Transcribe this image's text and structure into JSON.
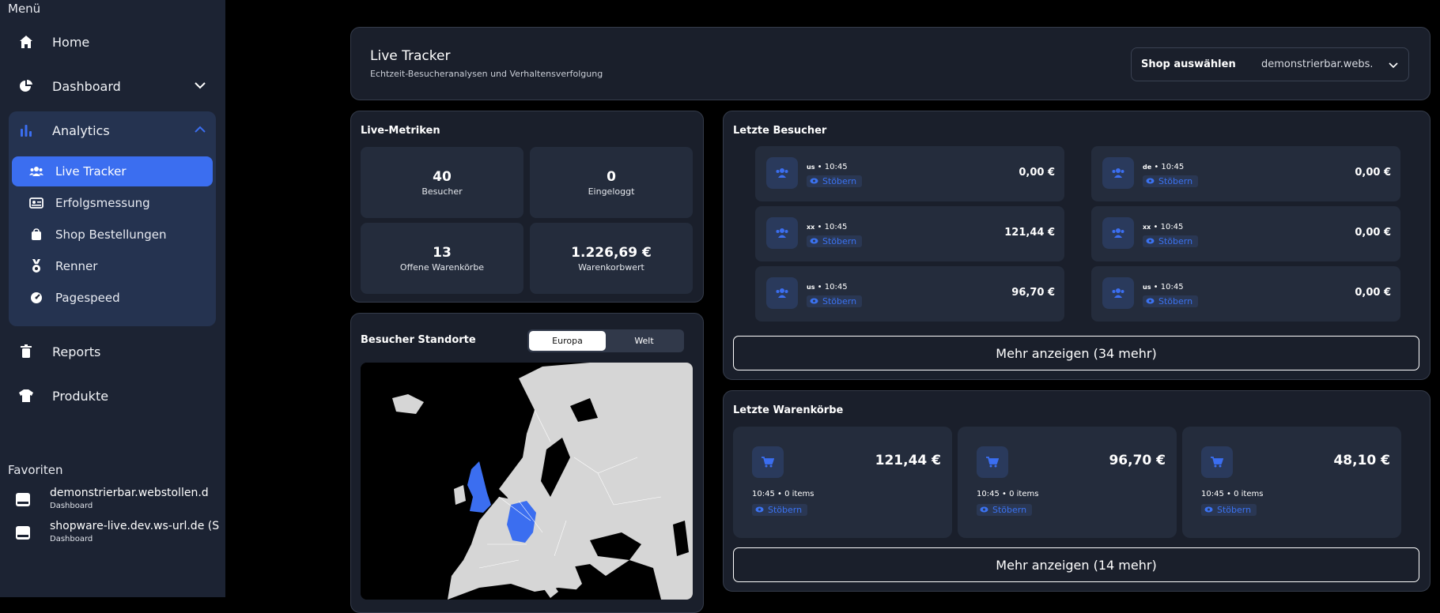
{
  "sidebar": {
    "menu_title": "Menü",
    "items": {
      "home": "Home",
      "dashboard": "Dashboard",
      "analytics": "Analytics",
      "reports": "Reports",
      "produkte": "Produkte"
    },
    "analytics_sub": {
      "live_tracker": "Live Tracker",
      "erfolgsmessung": "Erfolgsmessung",
      "shop_bestellungen": "Shop Bestellungen",
      "renner": "Renner",
      "pagespeed": "Pagespeed"
    },
    "favorites_title": "Favoriten",
    "favorites": [
      {
        "name": "demonstrierbar.webstollen.d",
        "sub": "Dashboard"
      },
      {
        "name": "shopware-live.dev.ws-url.de (S",
        "sub": "Dashboard"
      }
    ]
  },
  "header": {
    "title": "Live Tracker",
    "subtitle": "Echtzeit-Besucheranalysen und Verhaltensverfolgung",
    "shop_label": "Shop auswählen",
    "shop_value": "demonstrierbar.webs..."
  },
  "metrics": {
    "title": "Live-Metriken",
    "items": [
      {
        "value": "40",
        "label": "Besucher"
      },
      {
        "value": "0",
        "label": "Eingeloggt"
      },
      {
        "value": "13",
        "label": "Offene Warenkörbe"
      },
      {
        "value": "1.226,69 €",
        "label": "Warenkorbwert"
      }
    ]
  },
  "locations": {
    "title": "Besucher Standorte",
    "tab_europa": "Europa",
    "tab_welt": "Welt",
    "active_tab": "Europa",
    "highlight_color": "#3b6ef0"
  },
  "visitors": {
    "title": "Letzte Besucher",
    "items": [
      {
        "country": "us",
        "time": "• 10:45",
        "status": "Stöbern",
        "amount": "0,00 €"
      },
      {
        "country": "de",
        "time": "• 10:45",
        "status": "Stöbern",
        "amount": "0,00 €"
      },
      {
        "country": "xx",
        "time": "• 10:45",
        "status": "Stöbern",
        "amount": "121,44 €"
      },
      {
        "country": "xx",
        "time": "• 10:45",
        "status": "Stöbern",
        "amount": "0,00 €"
      },
      {
        "country": "us",
        "time": "• 10:45",
        "status": "Stöbern",
        "amount": "96,70 €"
      },
      {
        "country": "us",
        "time": "• 10:45",
        "status": "Stöbern",
        "amount": "0,00 €"
      }
    ],
    "more": "Mehr anzeigen (34 mehr)"
  },
  "carts": {
    "title": "Letzte Warenkörbe",
    "items": [
      {
        "amount": "121,44 €",
        "meta": "10:45 • 0 items",
        "status": "Stöbern"
      },
      {
        "amount": "96,70 €",
        "meta": "10:45 • 0 items",
        "status": "Stöbern"
      },
      {
        "amount": "48,10 €",
        "meta": "10:45 • 0 items",
        "status": "Stöbern"
      }
    ],
    "more": "Mehr anzeigen (14 mehr)"
  },
  "colors": {
    "accent": "#3b6ef0",
    "panel": "#1a1f2b",
    "sidebar": "#1c2333"
  }
}
